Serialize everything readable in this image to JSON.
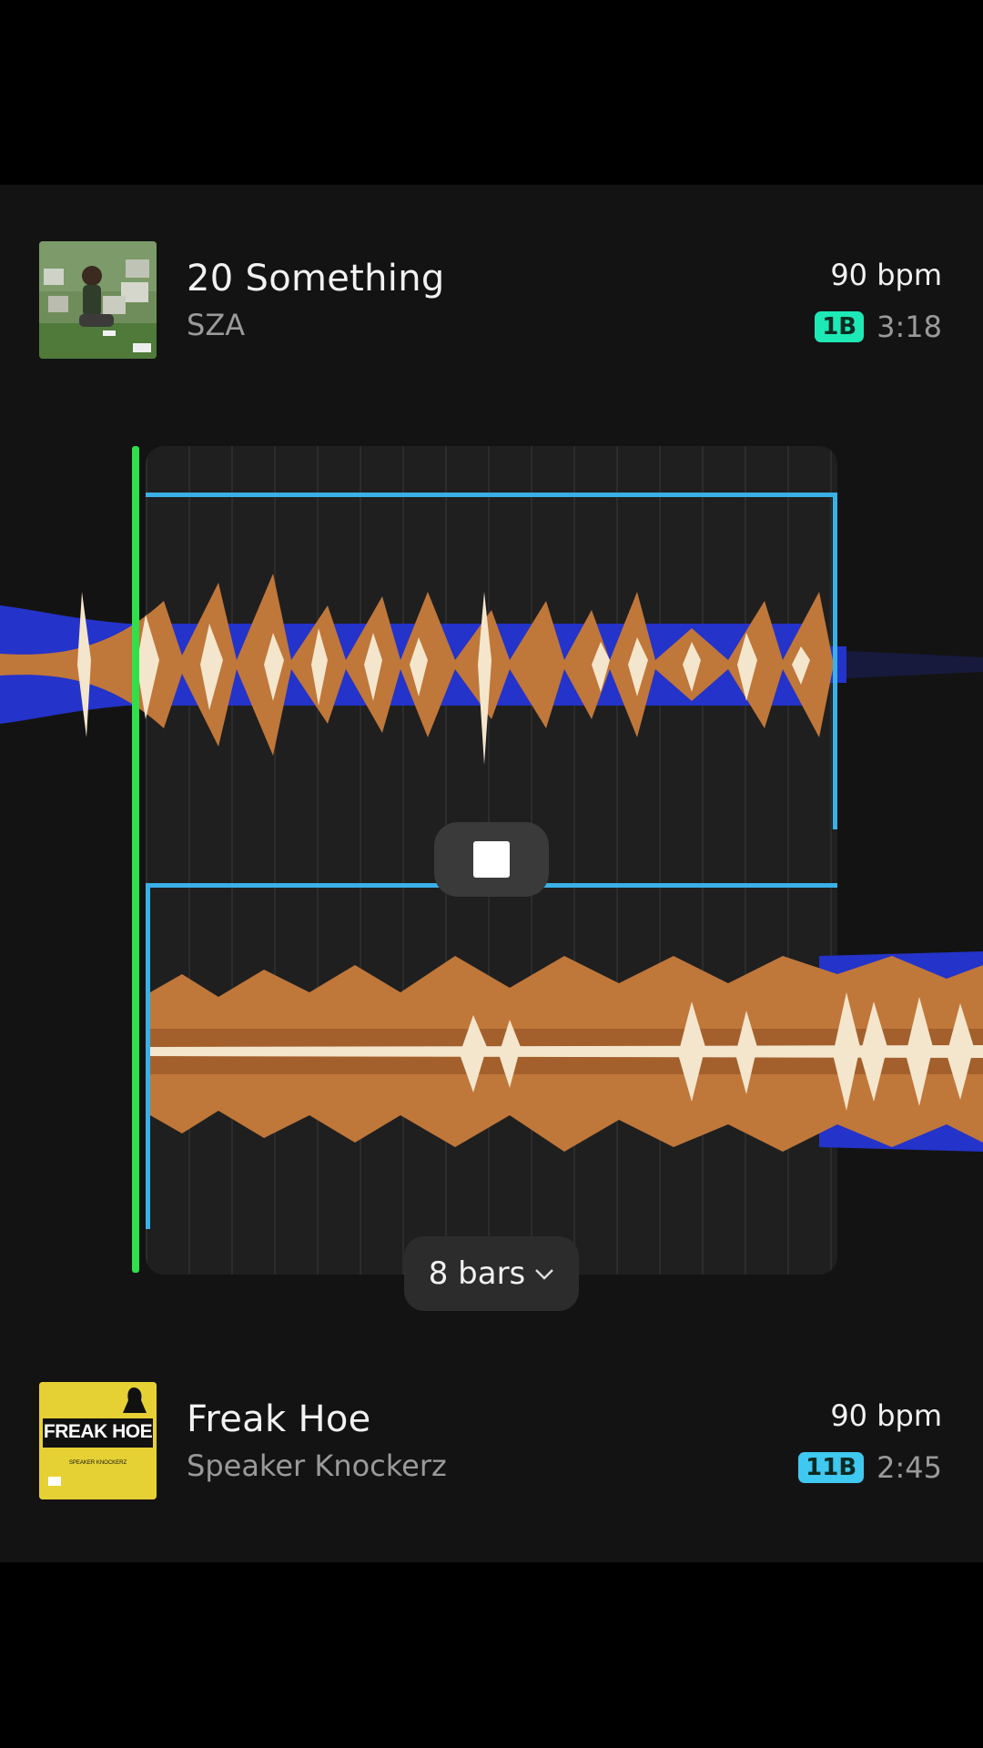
{
  "top_track": {
    "title": "20 Something",
    "artist": "SZA",
    "bpm": "90 bpm",
    "key": "1B",
    "key_color": "#1de9b6",
    "duration": "3:18"
  },
  "bottom_track": {
    "title": "Freak Hoe",
    "artist": "Speaker Knockerz",
    "bpm": "90 bpm",
    "key": "11B",
    "key_color": "#3fc8f0",
    "duration": "2:45",
    "cover_text": "FREAK HOE",
    "cover_subtext": "SPEAKER KNOCKERZ"
  },
  "controls": {
    "loop_length": "8 bars",
    "stop_icon": "stop-icon",
    "chevron_icon": "chevron-down-icon"
  },
  "colors": {
    "playhead": "#2fe04a",
    "loop_bracket": "#3ab0e6",
    "wave_blue": "#2433c9",
    "wave_orange": "#c0773a",
    "wave_cream": "#f4e6cc"
  }
}
